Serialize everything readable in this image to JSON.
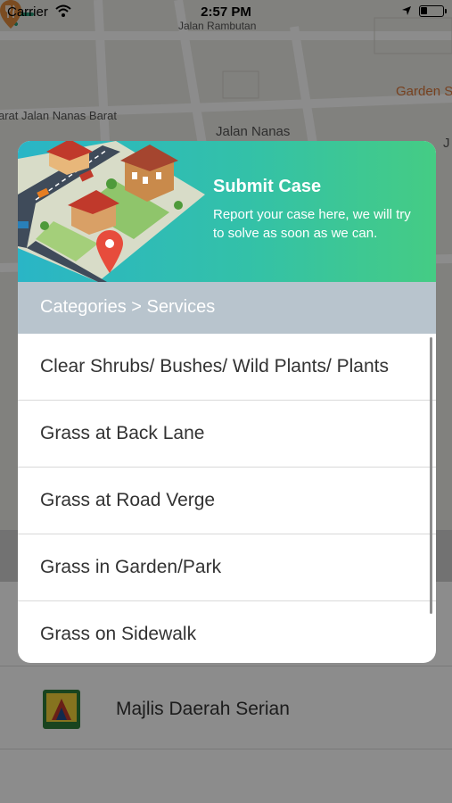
{
  "status_bar": {
    "carrier": "Carrier",
    "time": "2:57 PM"
  },
  "map": {
    "labels": {
      "jalan_rambutan": "Jalan Rambutan",
      "garden": "Garden S",
      "jalan_nanas_barat": "arat Jalan Nanas Barat",
      "jalan_nanas": "Jalan Nanas",
      "partial_j": "J"
    }
  },
  "background_list": {
    "org_name": "Majlis Daerah Serian"
  },
  "modal": {
    "title": "Submit Case",
    "description": "Report your case here, we will try to solve as soon as we can.",
    "breadcrumb": "Categories > Services",
    "items": [
      "Clear Shrubs/ Bushes/ Wild Plants/ Plants",
      "Grass at Back Lane",
      "Grass at Road Verge",
      "Grass in Garden/Park",
      "Grass on Sidewalk"
    ]
  },
  "colors": {
    "header_gradient_start": "#2ab5c6",
    "header_gradient_end": "#45cc84",
    "breadcrumb_bg": "#b8c4cd",
    "back_arrow": "#2a9d7a",
    "garden_label": "#d9773b"
  },
  "icons": {
    "back": "arrow-left-icon",
    "wifi": "wifi-icon",
    "location": "location-arrow-icon",
    "battery": "battery-icon",
    "restaurant_pin": "restaurant-pin-icon",
    "city_illustration": "city-illustration",
    "org_logo": "council-logo"
  }
}
